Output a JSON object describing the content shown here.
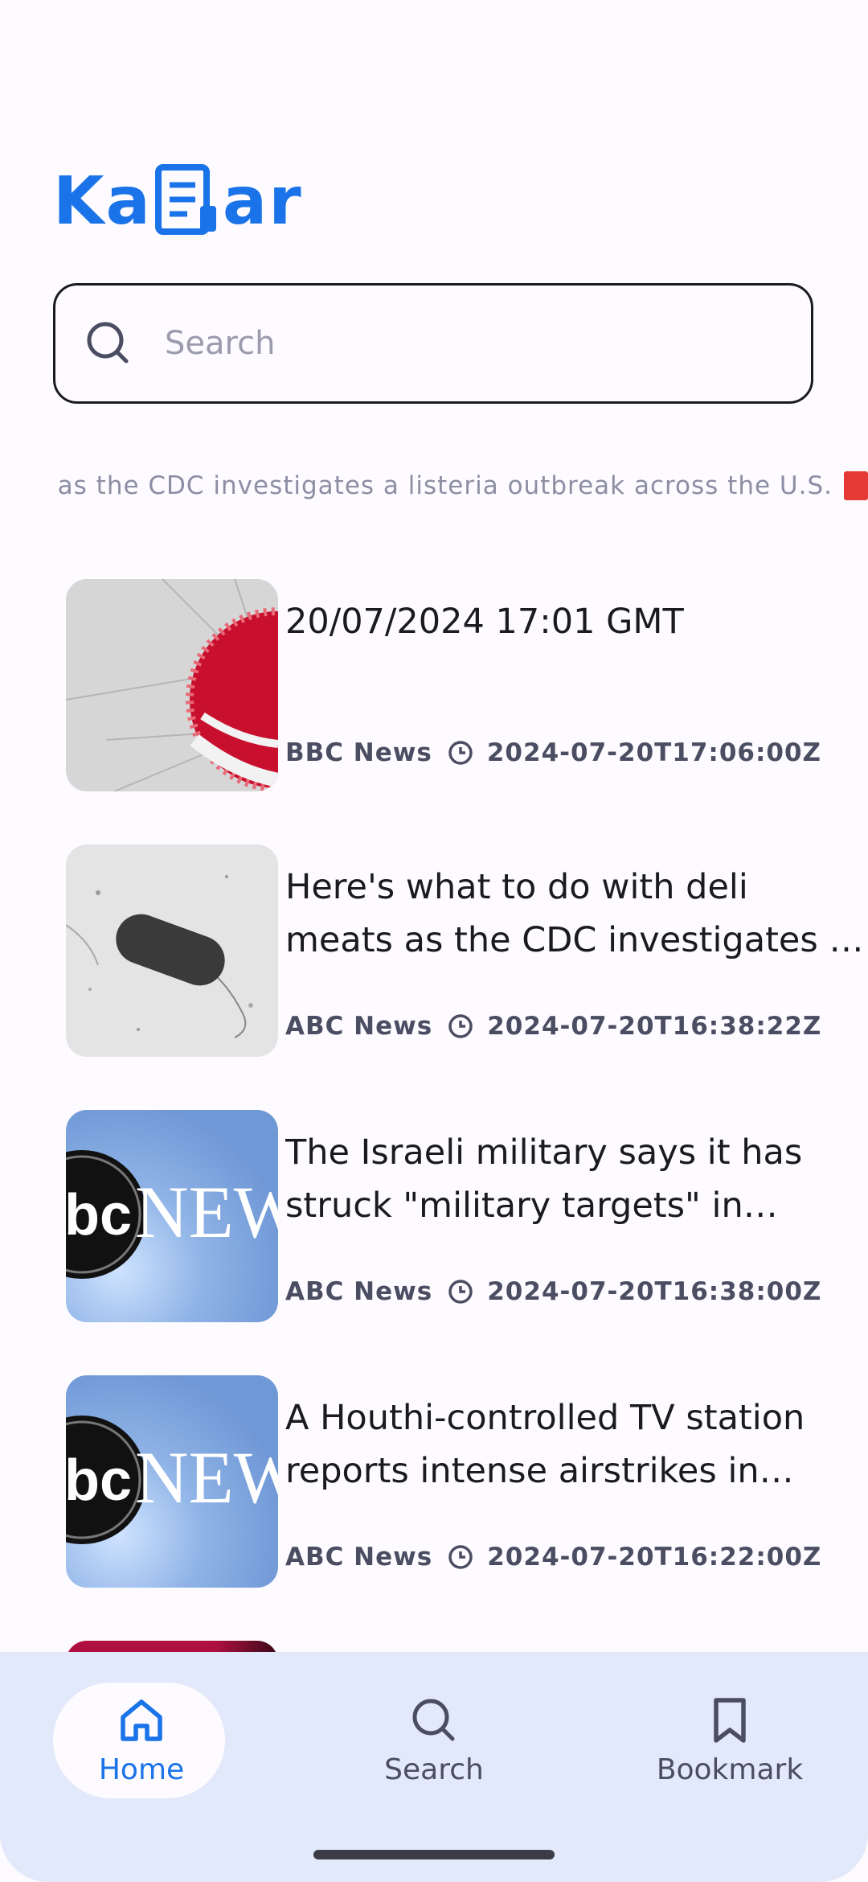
{
  "app": {
    "logo_text_left": "Ka",
    "logo_text_right": "ar",
    "brand_color": "#1a73e8"
  },
  "search": {
    "placeholder": "Search",
    "value": ""
  },
  "ticker": {
    "text": "ts as the CDC investigates a listeria outbreak across the U.S."
  },
  "articles": [
    {
      "title": "20/07/2024 17:01 GMT",
      "source": "BBC News",
      "timestamp": "2024-07-20T17:06:00Z",
      "thumbnail": "bbc-news-globe"
    },
    {
      "title": "Here's what to do with deli meats as the CDC investigates a listeria outbreak across the U.S.",
      "source": "ABC News",
      "timestamp": "2024-07-20T16:38:22Z",
      "thumbnail": "bacteria-micrograph"
    },
    {
      "title": "The Israeli military says it has struck \"military targets\" in Yemen",
      "source": "ABC News",
      "timestamp": "2024-07-20T16:38:00Z",
      "thumbnail": "abc-news-logo"
    },
    {
      "title": "A Houthi-controlled TV station reports intense airstrikes in Yemen",
      "source": "ABC News",
      "timestamp": "2024-07-20T16:22:00Z",
      "thumbnail": "abc-news-logo"
    }
  ],
  "bottom_nav": {
    "items": [
      {
        "label": "Home",
        "icon": "home-icon",
        "active": true
      },
      {
        "label": "Search",
        "icon": "search-icon",
        "active": false
      },
      {
        "label": "Bookmark",
        "icon": "bookmark-icon",
        "active": false
      }
    ]
  },
  "colors": {
    "background": "#fdfbff",
    "nav_background": "#e2e9fa",
    "text_primary": "#1b1b1f",
    "text_meta": "#4b4d62",
    "ticker_text": "#8c8ea3"
  }
}
